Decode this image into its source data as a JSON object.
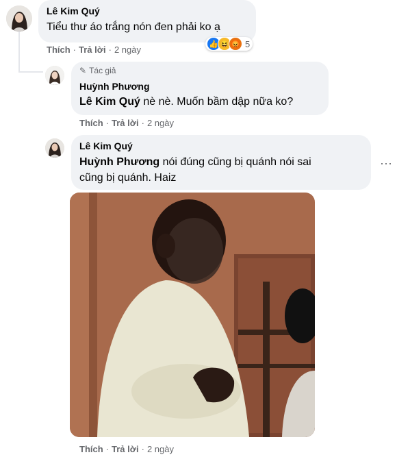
{
  "comments": [
    {
      "author": "Lê Kim Quý",
      "text": "Tiểu thư áo trắng nón đen phải ko ạ",
      "actions": {
        "like": "Thích",
        "reply": "Trả lời",
        "time": "2 ngày"
      },
      "reactions": {
        "icons": [
          "like-reaction",
          "haha-reaction",
          "angry-reaction"
        ],
        "count": "5"
      }
    },
    {
      "author_badge": "Tác giả",
      "author": "Huỳnh Phương",
      "mention": "Lê Kim Quý",
      "text": " nè nè. Muốn bầm dập nữa ko?",
      "actions": {
        "like": "Thích",
        "reply": "Trả lời",
        "time": "2 ngày"
      }
    },
    {
      "author": "Lê Kim Quý",
      "mention": "Huỳnh Phương",
      "text_line1": " nói đúng cũng bị quánh nói sai",
      "text_line2": "cũng bị quánh. Haiz",
      "more": "···",
      "actions": {
        "like": "Thích",
        "reply": "Trả lời",
        "time": "2 ngày"
      }
    }
  ],
  "colors": {
    "bubble": "#f0f2f5",
    "meta": "#65676b",
    "like": "#1877f2",
    "haha": "#f7b928",
    "angry": "#e9710f"
  }
}
